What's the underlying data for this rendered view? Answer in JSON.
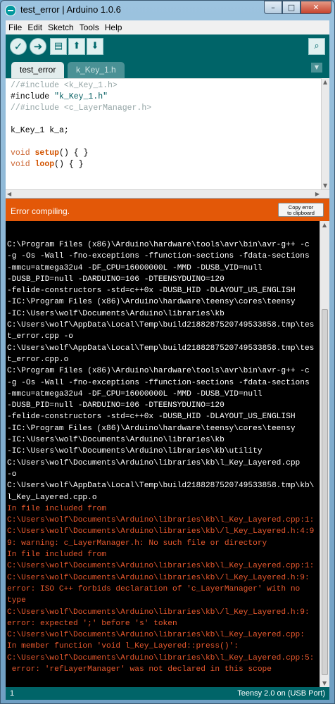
{
  "window": {
    "title": "test_error | Arduino 1.0.6"
  },
  "window_buttons": {
    "minimize": "–",
    "maximize": "□",
    "close": "✕"
  },
  "menu": [
    "File",
    "Edit",
    "Sketch",
    "Tools",
    "Help"
  ],
  "toolbar": {
    "verify_icon": "check-icon",
    "upload_icon": "arrow-right-icon",
    "new_icon": "new-file-icon",
    "open_icon": "open-up-arrow-icon",
    "save_icon": "save-down-arrow-icon",
    "serial_icon": "magnifier-icon"
  },
  "tabs": [
    {
      "label": "test_error",
      "active": true
    },
    {
      "label": "k_Key_1.h",
      "active": false
    }
  ],
  "editor": {
    "line1": "//#include <k_Key_1.h>",
    "line2a": "#include ",
    "line2b": "\"k_Key_1.h\"",
    "line3": "//#include <c_LayerManager.h>",
    "line5": "k_Key_1 k_a;",
    "line7_kw": "void",
    "line7_fn": "setup",
    "line7_rest": "() { }",
    "line8_kw": "void",
    "line8_fn": "loop",
    "line8_rest": "() { }"
  },
  "status": {
    "message": "Error compiling.",
    "copy_button_line1": "Copy error",
    "copy_button_line2": "to clipboard"
  },
  "console": {
    "lines": [
      {
        "text": "C:\\Program Files (x86)\\Arduino\\hardware\\tools\\avr\\bin\\avr-g++ -c",
        "kind": "white"
      },
      {
        "text": "-g -Os -Wall -fno-exceptions -ffunction-sections -fdata-sections",
        "kind": "white"
      },
      {
        "text": "-mmcu=atmega32u4 -DF_CPU=16000000L -MMD -DUSB_VID=null",
        "kind": "white"
      },
      {
        "text": "-DUSB_PID=null -DARDUINO=106 -DTEENSYDUINO=120",
        "kind": "white"
      },
      {
        "text": "-felide-constructors -std=c++0x -DUSB_HID -DLAYOUT_US_ENGLISH",
        "kind": "white"
      },
      {
        "text": "-IC:\\Program Files (x86)\\Arduino\\hardware\\teensy\\cores\\teensy",
        "kind": "white"
      },
      {
        "text": "-IC:\\Users\\wolf\\Documents\\Arduino\\libraries\\kb",
        "kind": "white"
      },
      {
        "text": "C:\\Users\\wolf\\AppData\\Local\\Temp\\build2188287520749533858.tmp\\tes",
        "kind": "white"
      },
      {
        "text": "t_error.cpp -o",
        "kind": "white"
      },
      {
        "text": "C:\\Users\\wolf\\AppData\\Local\\Temp\\build2188287520749533858.tmp\\tes",
        "kind": "white"
      },
      {
        "text": "t_error.cpp.o",
        "kind": "white"
      },
      {
        "text": "C:\\Program Files (x86)\\Arduino\\hardware\\tools\\avr\\bin\\avr-g++ -c",
        "kind": "white"
      },
      {
        "text": "-g -Os -Wall -fno-exceptions -ffunction-sections -fdata-sections",
        "kind": "white"
      },
      {
        "text": "-mmcu=atmega32u4 -DF_CPU=16000000L -MMD -DUSB_VID=null",
        "kind": "white"
      },
      {
        "text": "-DUSB_PID=null -DARDUINO=106 -DTEENSYDUINO=120",
        "kind": "white"
      },
      {
        "text": "-felide-constructors -std=c++0x -DUSB_HID -DLAYOUT_US_ENGLISH",
        "kind": "white"
      },
      {
        "text": "-IC:\\Program Files (x86)\\Arduino\\hardware\\teensy\\cores\\teensy",
        "kind": "white"
      },
      {
        "text": "-IC:\\Users\\wolf\\Documents\\Arduino\\libraries\\kb",
        "kind": "white"
      },
      {
        "text": "-IC:\\Users\\wolf\\Documents\\Arduino\\libraries\\kb\\utility",
        "kind": "white"
      },
      {
        "text": "C:\\Users\\wolf\\Documents\\Arduino\\libraries\\kb\\l_Key_Layered.cpp",
        "kind": "white"
      },
      {
        "text": "-o",
        "kind": "white"
      },
      {
        "text": "C:\\Users\\wolf\\AppData\\Local\\Temp\\build2188287520749533858.tmp\\kb\\",
        "kind": "white"
      },
      {
        "text": "l_Key_Layered.cpp.o",
        "kind": "white"
      },
      {
        "text": "In file included from",
        "kind": "error"
      },
      {
        "text": "C:\\Users\\wolf\\Documents\\Arduino\\libraries\\kb\\l_Key_Layered.cpp:1:",
        "kind": "error"
      },
      {
        "text": "C:\\Users\\wolf\\Documents\\Arduino\\libraries\\kb\\/l_Key_Layered.h:4:9",
        "kind": "error"
      },
      {
        "text": "9: warning: c_LayerManager.h: No such file or directory",
        "kind": "error"
      },
      {
        "text": "In file included from",
        "kind": "error"
      },
      {
        "text": "C:\\Users\\wolf\\Documents\\Arduino\\libraries\\kb\\l_Key_Layered.cpp:1:",
        "kind": "error"
      },
      {
        "text": "C:\\Users\\wolf\\Documents\\Arduino\\libraries\\kb\\/l_Key_Layered.h:9:",
        "kind": "error"
      },
      {
        "text": "error: ISO C++ forbids declaration of 'c_LayerManager' with no",
        "kind": "error"
      },
      {
        "text": "type",
        "kind": "error"
      },
      {
        "text": "C:\\Users\\wolf\\Documents\\Arduino\\libraries\\kb\\/l_Key_Layered.h:9:",
        "kind": "error"
      },
      {
        "text": "error: expected ';' before 's' token",
        "kind": "error"
      },
      {
        "text": "C:\\Users\\wolf\\Documents\\Arduino\\libraries\\kb\\l_Key_Layered.cpp:",
        "kind": "error"
      },
      {
        "text": "In member function 'void l_Key_Layered::press()':",
        "kind": "error"
      },
      {
        "text": "C:\\Users\\wolf\\Documents\\Arduino\\libraries\\kb\\l_Key_Layered.cpp:5:",
        "kind": "error"
      },
      {
        "text": " error: 'refLayerManager' was not declared in this scope",
        "kind": "error"
      }
    ]
  },
  "footer": {
    "line_number": "1",
    "board": "Teensy 2.0 on (USB Port)"
  },
  "colors": {
    "toolbar_bg": "#006468",
    "status_error_bg": "#e35808",
    "console_bg": "#000000",
    "console_error_text": "#e8592e"
  }
}
